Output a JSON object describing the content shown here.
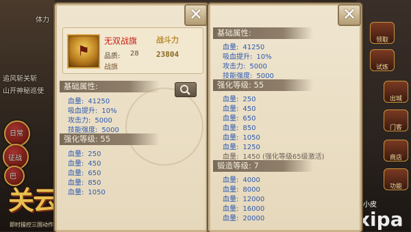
{
  "background": {
    "left_texts": [
      "体力",
      "追风斩关斩",
      "山开神秘巡使",
      "日常",
      "征战",
      "巴"
    ],
    "right_buttons": [
      "领取",
      "试炼",
      "出城",
      "门客",
      "商店",
      "功能"
    ],
    "logo": "关云长",
    "logo_tagline": "即时操控三国动作手游",
    "watermark": "xipa",
    "watermark_cn": "小皮"
  },
  "left_panel": {
    "close_label": "✕",
    "item": {
      "icon": "war-banner-icon",
      "name": "无双战旗",
      "quality_label": "品质:",
      "quality_value": "28",
      "type": "战旗",
      "power_label": "战斗力",
      "power_value": "23804"
    },
    "base_header": "基础属性:",
    "base_stats": [
      {
        "label": "血量:",
        "value": "41250"
      },
      {
        "label": "吸血提升:",
        "value": "10%"
      },
      {
        "label": "攻击力:",
        "value": "5000"
      },
      {
        "label": "技能强度:",
        "value": "5000"
      }
    ],
    "enhance_header": "强化等级: 55",
    "enhance_stats": [
      {
        "label": "血量:",
        "value": "250"
      },
      {
        "label": "血量:",
        "value": "450"
      },
      {
        "label": "血量:",
        "value": "650"
      },
      {
        "label": "血量:",
        "value": "850"
      },
      {
        "label": "血量:",
        "value": "1050"
      }
    ]
  },
  "right_panel": {
    "close_label": "✕",
    "base_header": "基础属性:",
    "base_stats": [
      {
        "label": "血量:",
        "value": "41250"
      },
      {
        "label": "吸血提升:",
        "value": "10%"
      },
      {
        "label": "攻击力:",
        "value": "5000"
      },
      {
        "label": "技能强度:",
        "value": "5000"
      }
    ],
    "enhance_header": "强化等级: 55",
    "enhance_stats": [
      {
        "label": "血量:",
        "value": "250"
      },
      {
        "label": "血量:",
        "value": "450"
      },
      {
        "label": "血量:",
        "value": "650"
      },
      {
        "label": "血量:",
        "value": "850"
      },
      {
        "label": "血量:",
        "value": "1050"
      },
      {
        "label": "血量:",
        "value": "1250"
      },
      {
        "label": "血量:",
        "value": "1450 (强化等级65级激活)"
      }
    ],
    "forge_header": "锻造等级: 7",
    "forge_stats": [
      {
        "label": "血量:",
        "value": "4000"
      },
      {
        "label": "血量:",
        "value": "8000"
      },
      {
        "label": "血量:",
        "value": "12000"
      },
      {
        "label": "血量:",
        "value": "16000"
      },
      {
        "label": "血量:",
        "value": "20000"
      }
    ]
  }
}
